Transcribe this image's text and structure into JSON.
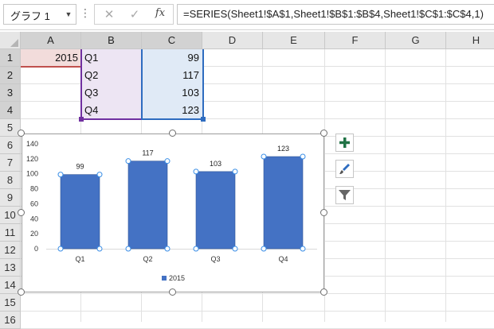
{
  "name_box": {
    "value": "グラフ 1"
  },
  "formula_bar": {
    "cancel_glyph": "✕",
    "enter_glyph": "✓",
    "fx_label": "fx",
    "formula": "=SERIES(Sheet1!$A$1,Sheet1!$B$1:$B$4,Sheet1!$C$1:$C$4,1)"
  },
  "columns": [
    "A",
    "B",
    "C",
    "D",
    "E",
    "F",
    "G",
    "H"
  ],
  "rows": [
    "1",
    "2",
    "3",
    "4",
    "5",
    "6",
    "7",
    "8",
    "9",
    "10",
    "11",
    "12",
    "13",
    "14",
    "15",
    "16"
  ],
  "cells": {
    "A1": "2015",
    "B1": "Q1",
    "B2": "Q2",
    "B3": "Q3",
    "B4": "Q4",
    "C1": "99",
    "C2": "117",
    "C3": "103",
    "C4": "123"
  },
  "colors": {
    "bar": "#4472c4",
    "series_name_range": "#f2dcdb",
    "category_range": "#ede5f3",
    "value_range": "#e0eaf6",
    "series_name_border": "#c0504d",
    "category_border": "#7030a0",
    "value_border": "#2e6cc0",
    "add_element_icon": "#217346"
  },
  "chart_data": {
    "type": "bar",
    "categories": [
      "Q1",
      "Q2",
      "Q3",
      "Q4"
    ],
    "series": [
      {
        "name": "2015",
        "values": [
          99,
          117,
          103,
          123
        ]
      }
    ],
    "data_labels": [
      "99",
      "117",
      "103",
      "123"
    ],
    "yticks": [
      0,
      20,
      40,
      60,
      80,
      100,
      120,
      140
    ],
    "ylim": [
      0,
      140
    ],
    "gridlines": false,
    "legend": "bottom",
    "selected_series": true
  },
  "chart_side_buttons": {
    "add": "plus-icon",
    "style": "brush-icon",
    "filter": "filter-icon"
  }
}
